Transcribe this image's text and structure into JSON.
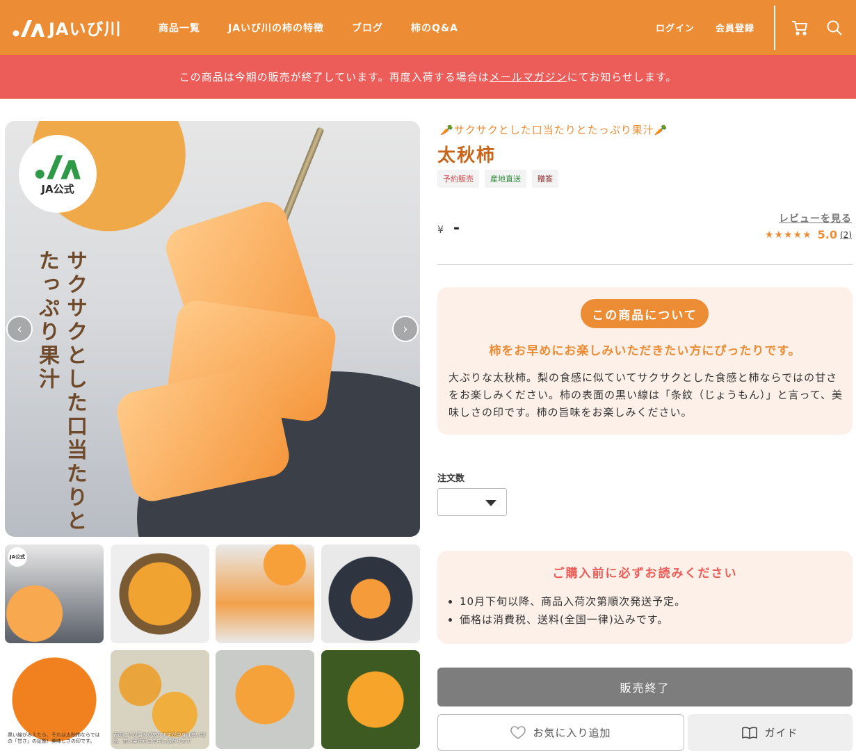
{
  "header": {
    "logo_text": "JAいび川",
    "nav": [
      "商品一覧",
      "JAいび川の柿の特徴",
      "ブログ",
      "柿のQ&A"
    ],
    "login": "ログイン",
    "register": "会員登録",
    "brand_color": "#ec8c34"
  },
  "notice": {
    "text_before": "この商品は今期の販売が終了しています。再度入荷する場合は",
    "link": "メールマガジン",
    "text_after": "にてお知らせします。",
    "color": "#ec5c58"
  },
  "gallery": {
    "badge": "JA公式",
    "overlay_line1": "サクサクとした口当たりと",
    "overlay_line2": "たっぷり果汁",
    "thumbs": [
      {
        "badge": "JA公式",
        "caption": ""
      },
      {
        "caption": ""
      },
      {
        "caption": ""
      },
      {
        "caption": ""
      },
      {
        "caption": "黒い線がみえたら、それは太秋柿ならではの「甘さ」の証拠！美味しさの印です。"
      },
      {
        "caption": "表面に汁が傷みがありますが中身は良い状態、甘い果汁が口の中に広がります"
      },
      {
        "caption": ""
      },
      {
        "caption": ""
      }
    ]
  },
  "product": {
    "tagline": "サクサクとした口当たりとたっぷり果汁",
    "title": "太秋柿",
    "badges": [
      "予約販売",
      "産地直送",
      "贈答"
    ],
    "price_symbol": "¥",
    "price": "-",
    "review_link": "レビューを見る",
    "stars": "★★★★★",
    "rating": "5.0",
    "rating_count": "(2)"
  },
  "about": {
    "pill": "この商品について",
    "lead": "柿をお早めにお楽しみいただきたい方にぴったりです。",
    "body": "大ぶりな太秋柿。梨の食感に似ていてサクサクとした食感と柿ならではの甘さをお楽しみください。柿の表面の黒い線は「条紋（じょうもん）」と言って、美味しさの印です。柿の旨味をお楽しみください。"
  },
  "order": {
    "qty_label": "注文数",
    "qty_value": ""
  },
  "notes": {
    "title": "ご購入前に必ずお読みください",
    "items": [
      "10月下旬以降、商品入荷次第順次発送予定。",
      "価格は消費税、送料(全国一律)込みです。"
    ]
  },
  "actions": {
    "soldout": "販売終了",
    "favorite": "お気に入り追加",
    "guide": "ガイド"
  }
}
